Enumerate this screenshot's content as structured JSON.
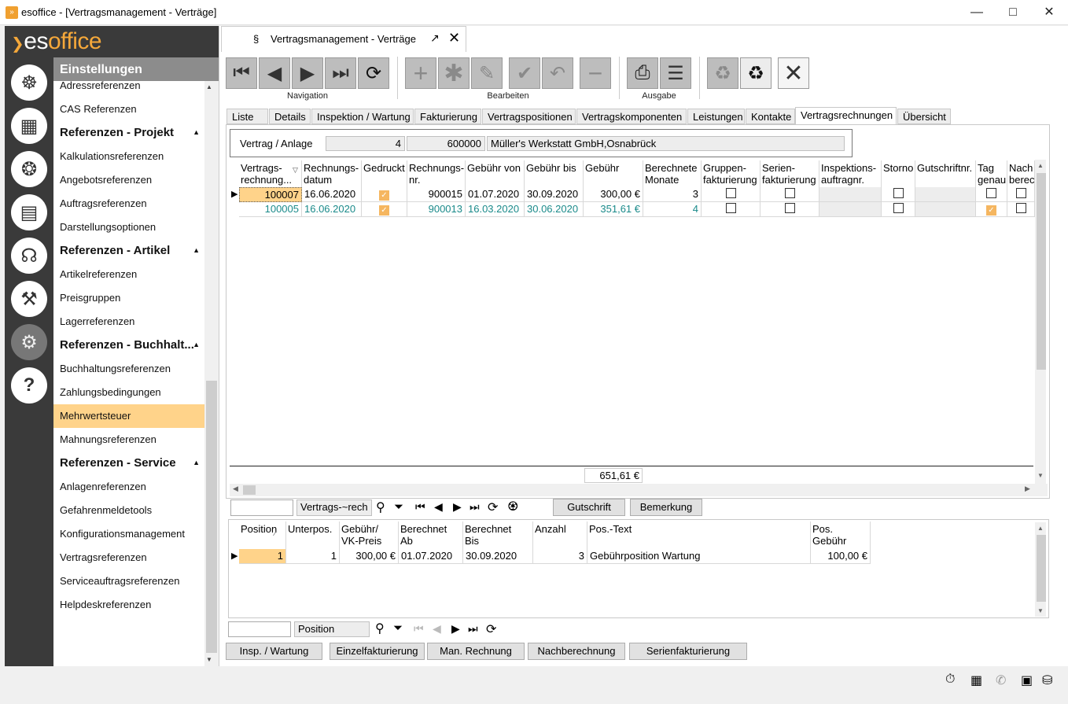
{
  "window": {
    "title": "esoffice - [Vertragsmanagement - Verträge]",
    "app_icon": "app-icon"
  },
  "logo": {
    "prefix": "es",
    "suffix": "office"
  },
  "rail_icons": [
    "helm-icon",
    "calculator-icon",
    "alarm-icon",
    "money-icon",
    "headset-icon",
    "tools-icon",
    "gears-icon",
    "help-icon"
  ],
  "nav": {
    "header": "Einstellungen",
    "items": [
      {
        "type": "item",
        "label": "Adressreferenzen"
      },
      {
        "type": "item",
        "label": "CAS Referenzen"
      },
      {
        "type": "section",
        "label": "Referenzen - Projekt"
      },
      {
        "type": "item",
        "label": "Kalkulationsreferenzen"
      },
      {
        "type": "item",
        "label": "Angebotsreferenzen"
      },
      {
        "type": "item",
        "label": "Auftragsreferenzen"
      },
      {
        "type": "item",
        "label": "Darstellungsoptionen"
      },
      {
        "type": "section",
        "label": "Referenzen - Artikel"
      },
      {
        "type": "item",
        "label": "Artikelreferenzen"
      },
      {
        "type": "item",
        "label": "Preisgruppen"
      },
      {
        "type": "item",
        "label": "Lagerreferenzen"
      },
      {
        "type": "section",
        "label": "Referenzen - Buchhalt..."
      },
      {
        "type": "item",
        "label": "Buchhaltungsreferenzen"
      },
      {
        "type": "item",
        "label": "Zahlungsbedingungen"
      },
      {
        "type": "item",
        "label": "Mehrwertsteuer",
        "selected": true
      },
      {
        "type": "item",
        "label": "Mahnungsreferenzen"
      },
      {
        "type": "section",
        "label": "Referenzen - Service"
      },
      {
        "type": "item",
        "label": "Anlagenreferenzen"
      },
      {
        "type": "item",
        "label": "Gefahrenmeldetools"
      },
      {
        "type": "item",
        "label": "Konfigurationsmanagement"
      },
      {
        "type": "item",
        "label": "Vertragsreferenzen"
      },
      {
        "type": "item",
        "label": "Serviceauftragsreferenzen"
      },
      {
        "type": "item",
        "label": "Helpdeskreferenzen"
      }
    ]
  },
  "doc_tab": {
    "symbol": "§",
    "title": "Vertragsmanagement - Verträge"
  },
  "toolbar": {
    "navigation_label": "Navigation",
    "bearbeiten_label": "Bearbeiten",
    "ausgabe_label": "Ausgabe"
  },
  "tabs": [
    "Liste",
    "Details",
    "Inspektion / Wartung",
    "Fakturierung",
    "Vertragspositionen",
    "Vertragskomponenten",
    "Leistungen",
    "Kontakte",
    "Vertragsrechnungen",
    "Übersicht"
  ],
  "active_tab": "Vertragsrechnungen",
  "vertrag": {
    "label": "Vertrag / Anlage",
    "nr": "4",
    "anlage": "600000",
    "name": "Müller's Werkstatt GmbH,Osnabrück"
  },
  "grid1": {
    "headers": [
      "Vertrags-\nrechnung...",
      "Rechnungs-\ndatum",
      "Gedruckt",
      "Rechnungs-\nnr.",
      "Gebühr von",
      "Gebühr bis",
      "Gebühr",
      "Berechnete\nMonate",
      "Gruppen-\nfakturierung",
      "Serien-\nfakturierung",
      "Inspektions-\nauftragnr.",
      "Storno",
      "Gutschriftnr.",
      "Tag\ngenau",
      "Nach\nberec"
    ],
    "rows": [
      {
        "nr": "100007",
        "datum": "16.06.2020",
        "gedruckt": true,
        "rnr": "900015",
        "von": "01.07.2020",
        "bis": "30.09.2020",
        "gebuehr": "300,00 €",
        "monate": "3",
        "gruppe": false,
        "serie": false,
        "insp": "",
        "storno": false,
        "gutschrift": "",
        "tag": false,
        "nach": false
      },
      {
        "nr": "100005",
        "datum": "16.06.2020",
        "gedruckt": true,
        "rnr": "900013",
        "von": "16.03.2020",
        "bis": "30.06.2020",
        "gebuehr": "351,61 €",
        "monate": "4",
        "gruppe": false,
        "serie": false,
        "insp": "",
        "storno": false,
        "gutschrift": "",
        "tag": true,
        "nach": false
      }
    ],
    "total": "651,61 €"
  },
  "filter1": {
    "field": "Vertrags-~rech",
    "gutschrift_label": "Gutschrift",
    "bemerkung_label": "Bemerkung"
  },
  "grid2": {
    "headers": [
      "Position",
      "Unterpos.",
      "Gebühr/\nVK-Preis",
      "Berechnet\nAb",
      "Berechnet\nBis",
      "Anzahl",
      "Pos.-Text",
      "Pos.\nGebühr"
    ],
    "rows": [
      {
        "pos": "1",
        "unterpos": "1",
        "preis": "300,00 €",
        "ab": "01.07.2020",
        "bis": "30.09.2020",
        "anzahl": "3",
        "text": "Gebührposition Wartung",
        "gebuehr": "100,00 €"
      }
    ]
  },
  "filter2": {
    "field": "Position"
  },
  "bottom_buttons": [
    "Insp. / Wartung",
    "Einzelfakturierung",
    "Man. Rechnung",
    "Nachberechnung",
    "Serienfakturierung"
  ],
  "status_icons": [
    "stopwatch-icon",
    "building-icon",
    "phone-icon",
    "lock-icon",
    "database-icon"
  ]
}
